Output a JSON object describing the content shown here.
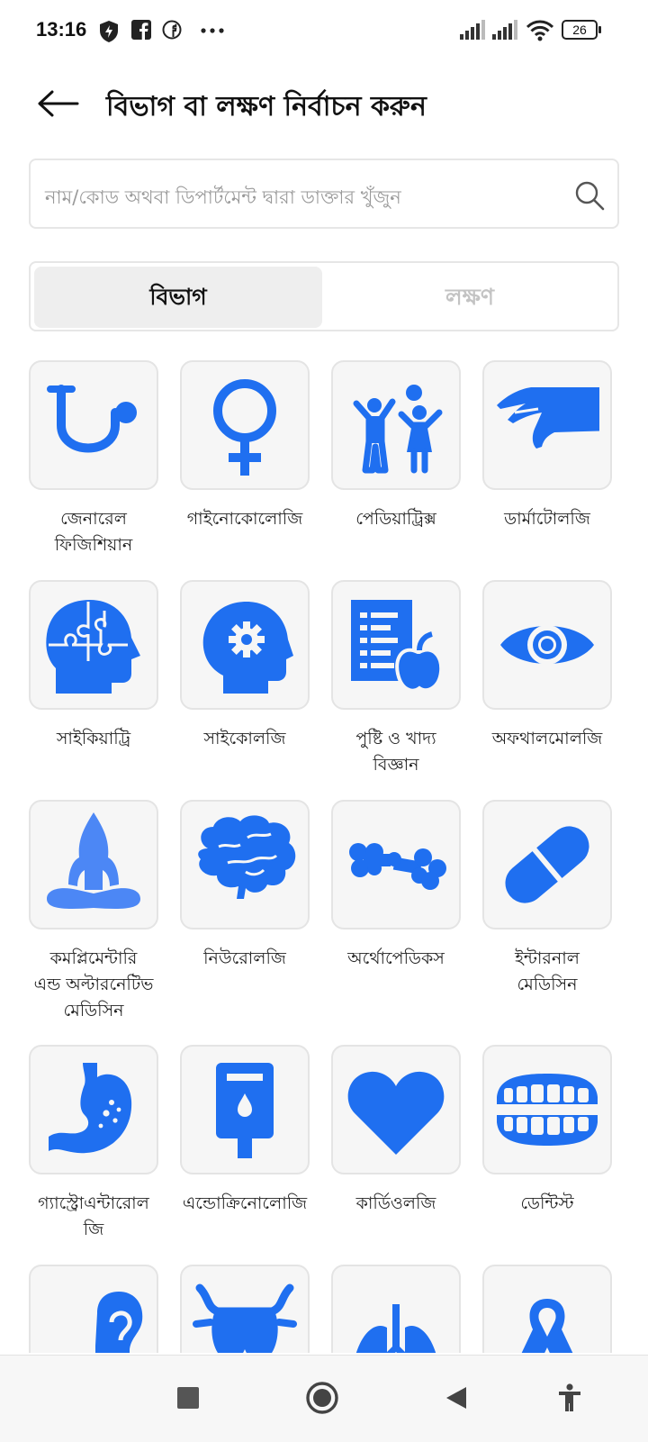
{
  "status_bar": {
    "time": "13:16",
    "battery": "26",
    "icons": [
      "shield-icon",
      "facebook-icon",
      "messenger-icon",
      "more-icon",
      "signal-icon",
      "signal-icon",
      "wifi-icon",
      "battery-icon"
    ]
  },
  "header": {
    "title": "বিভাগ বা লক্ষণ নির্বাচন করুন",
    "back_icon": "arrow-left-icon"
  },
  "search": {
    "placeholder": "নাম/কোড অথবা ডিপার্টমেন্ট দ্বারা ডাক্তার খুঁজুন",
    "icon": "search-icon"
  },
  "tabs": [
    {
      "label": "বিভাগ",
      "active": true
    },
    {
      "label": "লক্ষণ",
      "active": false
    }
  ],
  "accent_color": "#1f6ff0",
  "departments": [
    {
      "label": "জেনারেল\nফিজিশিয়ান",
      "icon": "stethoscope-icon"
    },
    {
      "label": "গাইনোকোলোজি",
      "icon": "female-symbol-icon"
    },
    {
      "label": "পেডিয়াট্রিক্স",
      "icon": "children-icon"
    },
    {
      "label": "ডার্মাটোলজি",
      "icon": "hand-icon"
    },
    {
      "label": "সাইকিয়াট্রি",
      "icon": "head-puzzle-icon"
    },
    {
      "label": "সাইকোলজি",
      "icon": "head-gear-icon"
    },
    {
      "label": "পুষ্টি ও খাদ্য\nবিজ্ঞান",
      "icon": "diet-chart-apple-icon"
    },
    {
      "label": "অফথালমোলজি",
      "icon": "eye-icon"
    },
    {
      "label": "কমপ্লিমেন্টারি\nএন্ড অল্টারনেটিভ\nমেডিসিন",
      "icon": "yoga-icon"
    },
    {
      "label": "নিউরোলজি",
      "icon": "brain-icon"
    },
    {
      "label": "অর্থোপেডিকস",
      "icon": "bone-icon"
    },
    {
      "label": "ইন্টারনাল\nমেডিসিন",
      "icon": "pill-icon"
    },
    {
      "label": "গ্যাস্ট্রোএন্টারোল\nজি",
      "icon": "stomach-icon"
    },
    {
      "label": "এন্ডোক্রিনোলোজি",
      "icon": "glucometer-icon"
    },
    {
      "label": "কার্ডিওলজি",
      "icon": "heart-icon"
    },
    {
      "label": "ডেন্টিস্ট",
      "icon": "teeth-icon"
    },
    {
      "label": "",
      "icon": "ear-icon"
    },
    {
      "label": "",
      "icon": "thyroid-icon"
    },
    {
      "label": "",
      "icon": "lungs-icon"
    },
    {
      "label": "",
      "icon": "ribbon-icon"
    }
  ],
  "nav": [
    "recents-icon",
    "home-icon",
    "back-icon",
    "accessibility-icon"
  ]
}
